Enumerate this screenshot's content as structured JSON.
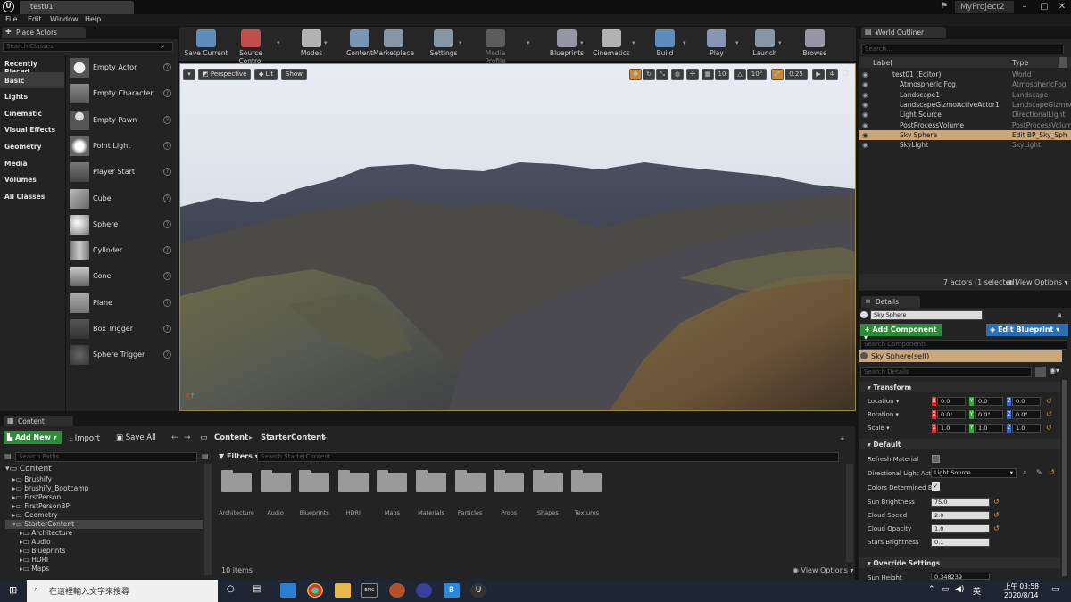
{
  "titlebar": {
    "doc_tab": "test01",
    "project": "MyProject2"
  },
  "menu": [
    "File",
    "Edit",
    "Window",
    "Help"
  ],
  "place_actors": {
    "tab": "Place Actors",
    "search_placeholder": "Search Classes",
    "categories": [
      "Recently Placed",
      "Basic",
      "Lights",
      "Cinematic",
      "Visual Effects",
      "Geometry",
      "Media",
      "Volumes",
      "All Classes"
    ],
    "selected_category": "Basic",
    "actors": [
      "Empty Actor",
      "Empty Character",
      "Empty Pawn",
      "Point Light",
      "Player Start",
      "Cube",
      "Sphere",
      "Cylinder",
      "Cone",
      "Plane",
      "Box Trigger",
      "Sphere Trigger"
    ]
  },
  "toolbar": [
    "Save Current",
    "Source Control",
    "Modes",
    "Content",
    "Marketplace",
    "Settings",
    "Media Profile",
    "Blueprints",
    "Cinematics",
    "Build",
    "Play",
    "Launch",
    "Browse"
  ],
  "viewport": {
    "perspective": "Perspective",
    "lit": "Lit",
    "show": "Show",
    "grid_snap": "10",
    "rot_snap": "10°",
    "scale_snap": "0.25",
    "cam_speed": "4"
  },
  "world_outliner": {
    "tab": "World Outliner",
    "search_placeholder": "Search...",
    "col_label": "Label",
    "col_type": "Type",
    "rows": [
      {
        "label": "test01 (Editor)",
        "type": "World"
      },
      {
        "label": "Atmospheric Fog",
        "type": "AtmosphericFog"
      },
      {
        "label": "Landscape1",
        "type": "Landscape"
      },
      {
        "label": "LandscapeGizmoActiveActor1",
        "type": "LandscapeGizmoA"
      },
      {
        "label": "Light Source",
        "type": "DirectionalLight"
      },
      {
        "label": "PostProcessVolume",
        "type": "PostProcessVolum"
      },
      {
        "label": "Sky Sphere",
        "type": "Edit BP_Sky_Sph"
      },
      {
        "label": "SkyLight",
        "type": "SkyLight"
      }
    ],
    "selected_row": "Sky Sphere",
    "status": "7 actors (1 selected)",
    "view_options": "View Options"
  },
  "details": {
    "tab": "Details",
    "name": "Sky Sphere",
    "add_component": "+ Add Component",
    "edit_blueprint": "Edit Blueprint",
    "search_components": "Search Components",
    "self_component": "Sky Sphere(self)",
    "search_details": "Search Details",
    "transform": "Transform",
    "location_label": "Location",
    "rotation_label": "Rotation",
    "scale_label": "Scale",
    "location": [
      "0.0",
      "0.0",
      "0.0"
    ],
    "rotation": [
      "0.0°",
      "0.0°",
      "0.0°"
    ],
    "scale": [
      "1.0",
      "1.0",
      "1.0"
    ],
    "default": "Default",
    "refresh_material": "Refresh Material",
    "directional_light_actor_label": "Directional Light Actor",
    "directional_light_actor": "Light Source",
    "colors_determined_by": "Colors Determined By",
    "sun_brightness_label": "Sun Brightness",
    "sun_brightness": "75.0",
    "cloud_speed_label": "Cloud Speed",
    "cloud_speed": "2.0",
    "cloud_opacity_label": "Cloud Opacity",
    "cloud_opacity": "1.0",
    "stars_brightness_label": "Stars Brightness",
    "stars_brightness": "0.1",
    "override_settings": "Override Settings",
    "sun_height_label": "Sun Height",
    "sun_height": "0.348239"
  },
  "content_browser": {
    "tab": "Content Browser",
    "add_new": "Add New",
    "import": "Import",
    "save_all": "Save All",
    "crumbs": [
      "Content",
      "StarterContent"
    ],
    "search_paths": "Search Paths",
    "filters": "Filters",
    "search_content": "Search StarterContent",
    "tree": [
      "Content",
      "Brushify",
      "brushify_Bootcamp",
      "FirstPerson",
      "FirstPersonBP",
      "Geometry",
      "StarterContent",
      "Architecture",
      "Audio",
      "Blueprints",
      "HDRI",
      "Maps"
    ],
    "folders": [
      "Architecture",
      "Audio",
      "Blueprints",
      "HDRI",
      "Maps",
      "Materials",
      "Particles",
      "Props",
      "Shapes",
      "Textures"
    ],
    "count": "10 items",
    "view_options": "View Options"
  },
  "taskbar": {
    "search_placeholder": "在這裡輸入文字來搜尋",
    "ime": "英",
    "ampm": "上午",
    "time": "03:58",
    "date": "2020/8/14"
  }
}
